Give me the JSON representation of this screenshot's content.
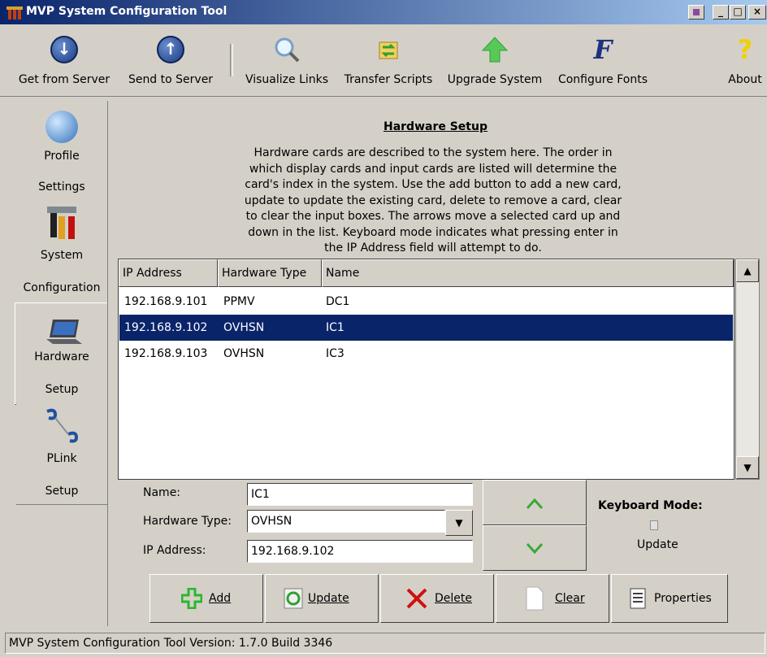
{
  "window": {
    "title": "MVP System Configuration Tool"
  },
  "toolbar": {
    "get_from_server": "Get from Server",
    "send_to_server": "Send to Server",
    "visualize_links": "Visualize Links",
    "transfer_scripts": "Transfer Scripts",
    "upgrade_system": "Upgrade System",
    "configure_fonts": "Configure Fonts",
    "about": "About"
  },
  "nav": [
    {
      "line1": "Profile",
      "line2": "Settings",
      "icon": "globe-icon"
    },
    {
      "line1": "System",
      "line2": "Configuration",
      "icon": "tools-icon"
    },
    {
      "line1": "Hardware",
      "line2": "Setup",
      "icon": "laptop-icon"
    },
    {
      "line1": "PLink",
      "line2": "Setup",
      "icon": "link-icon"
    }
  ],
  "main": {
    "heading": "Hardware Setup",
    "description": "Hardware cards are described to the system here.  The order in which display cards and input cards are listed will determine the card's index in the system.  Use the add button to add a new card, update to update the existing card, delete to remove a card, clear to clear the input boxes.  The arrows move a selected card up and down in the list.  Keyboard mode indicates what pressing enter in the IP Address field will attempt to do."
  },
  "list": {
    "columns": [
      "IP Address",
      "Hardware Type",
      "Name"
    ],
    "rows": [
      {
        "ip": "192.168.9.101",
        "type": "PPMV",
        "name": "DC1"
      },
      {
        "ip": "192.168.9.102",
        "type": "OVHSN",
        "name": "IC1"
      },
      {
        "ip": "192.168.9.103",
        "type": "OVHSN",
        "name": "IC3"
      }
    ],
    "selected_index": 1
  },
  "form": {
    "name_label": "Name:",
    "name_value": "IC1",
    "type_label": "Hardware Type:",
    "type_value": "OVHSN",
    "ip_label": "IP Address:",
    "ip_value": "192.168.9.102"
  },
  "keyboard_mode": {
    "label": "Keyboard Mode:",
    "value": "Update"
  },
  "buttons": {
    "add": "Add",
    "update": "Update",
    "delete": "Delete",
    "clear": "Clear",
    "properties": "Properties"
  },
  "status": "MVP System Configuration Tool Version: 1.7.0 Build 3346",
  "colors": {
    "title_bar": "#0a246a",
    "selection": "#0a246a",
    "face": "#d4d0c8",
    "add_green": "#2ab82a",
    "delete_red": "#d01010",
    "arrow_green": "#38a838"
  }
}
